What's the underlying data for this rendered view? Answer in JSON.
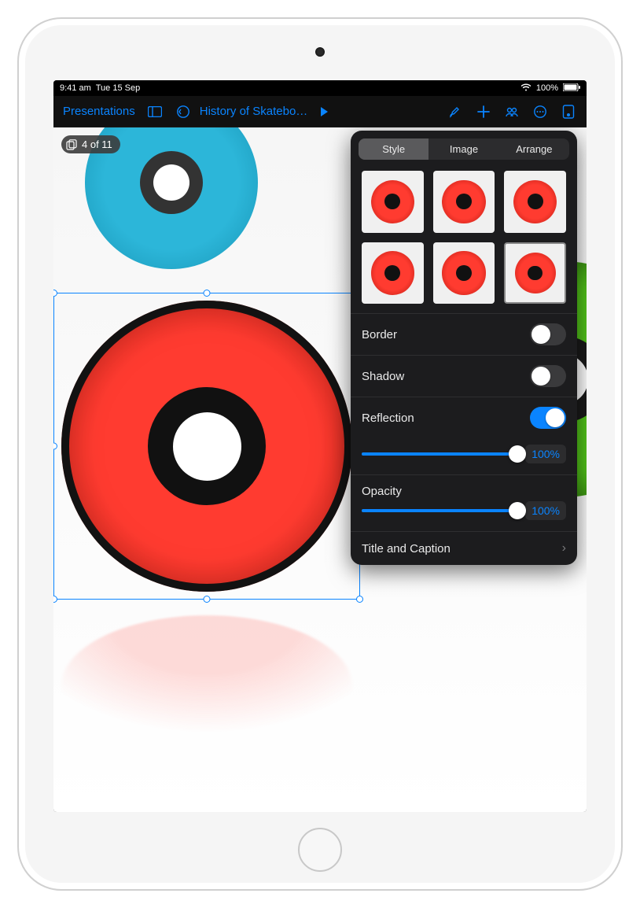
{
  "status": {
    "time": "9:41 am",
    "date": "Tue 15 Sep",
    "battery": "100%"
  },
  "toolbar": {
    "back_label": "Presentations",
    "doc_title": "History of Skatebo…"
  },
  "slide_counter": "4 of 11",
  "panel": {
    "tabs": {
      "style": "Style",
      "image": "Image",
      "arrange": "Arrange"
    },
    "border_label": "Border",
    "border_on": false,
    "shadow_label": "Shadow",
    "shadow_on": false,
    "reflection_label": "Reflection",
    "reflection_on": true,
    "reflection_value": "100%",
    "reflection_pct": 100,
    "opacity_label": "Opacity",
    "opacity_value": "100%",
    "opacity_pct": 100,
    "title_caption_label": "Title and Caption"
  }
}
